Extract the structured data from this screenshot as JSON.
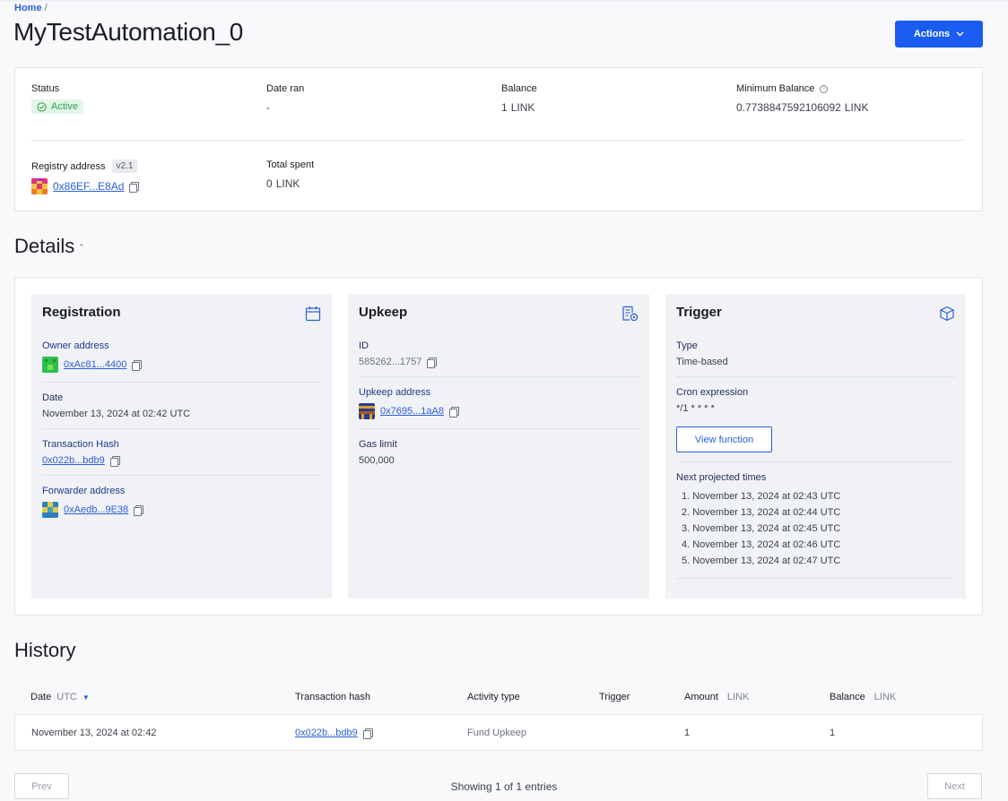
{
  "breadcrumb": {
    "home": "Home",
    "separator": "/"
  },
  "page": {
    "title": "MyTestAutomation_0"
  },
  "actions": {
    "label": "Actions"
  },
  "summary": {
    "status_label": "Status",
    "status_value": "Active",
    "date_ran_label": "Date ran",
    "date_ran_value": "-",
    "balance_label": "Balance",
    "balance_value": "1",
    "balance_unit": "LINK",
    "min_balance_label": "Minimum Balance",
    "min_balance_value": "0.7738847592106092",
    "min_balance_unit": "LINK",
    "registry_label": "Registry address",
    "registry_version": "v2.1",
    "registry_address": "0x86EF...E8Ad",
    "total_spent_label": "Total spent",
    "total_spent_value": "0",
    "total_spent_unit": "LINK"
  },
  "details": {
    "title": "Details",
    "registration": {
      "title": "Registration",
      "owner_label": "Owner address",
      "owner_value": "0xAc81...4400",
      "date_label": "Date",
      "date_value": "November 13, 2024 at 02:42 UTC",
      "tx_label": "Transaction Hash",
      "tx_value": "0x022b...bdb9",
      "forwarder_label": "Forwarder address",
      "forwarder_value": "0xAedb...9E38"
    },
    "upkeep": {
      "title": "Upkeep",
      "id_label": "ID",
      "id_value": "585262...1757",
      "address_label": "Upkeep address",
      "address_value": "0x7695...1aA8",
      "gas_label": "Gas limit",
      "gas_value": "500,000"
    },
    "trigger": {
      "title": "Trigger",
      "type_label": "Type",
      "type_value": "Time-based",
      "cron_label": "Cron expression",
      "cron_value": "*/1 * * * *",
      "view_function": "View function",
      "projected_label": "Next projected times",
      "projected": [
        "1. November 13, 2024 at 02:43 UTC",
        "2. November 13, 2024 at 02:44 UTC",
        "3. November 13, 2024 at 02:45 UTC",
        "4. November 13, 2024 at 02:46 UTC",
        "5. November 13, 2024 at 02:47 UTC"
      ]
    }
  },
  "history": {
    "title": "History",
    "columns": {
      "date": "Date",
      "date_unit": "UTC",
      "tx": "Transaction hash",
      "activity": "Activity type",
      "trigger": "Trigger",
      "amount": "Amount",
      "amount_unit": "LINK",
      "balance": "Balance",
      "balance_unit": "LINK"
    },
    "rows": [
      {
        "date": "November 13, 2024 at 02:42",
        "tx": "0x022b...bdb9",
        "activity": "Fund Upkeep",
        "trigger": "",
        "amount": "1",
        "balance": "1"
      }
    ]
  },
  "pagination": {
    "prev": "Prev",
    "next": "Next",
    "showing": "Showing 1 of 1 entries"
  },
  "colors": {
    "accent": "#1a5cf0",
    "link": "#2b5fd9",
    "active_green": "#27a04a"
  }
}
